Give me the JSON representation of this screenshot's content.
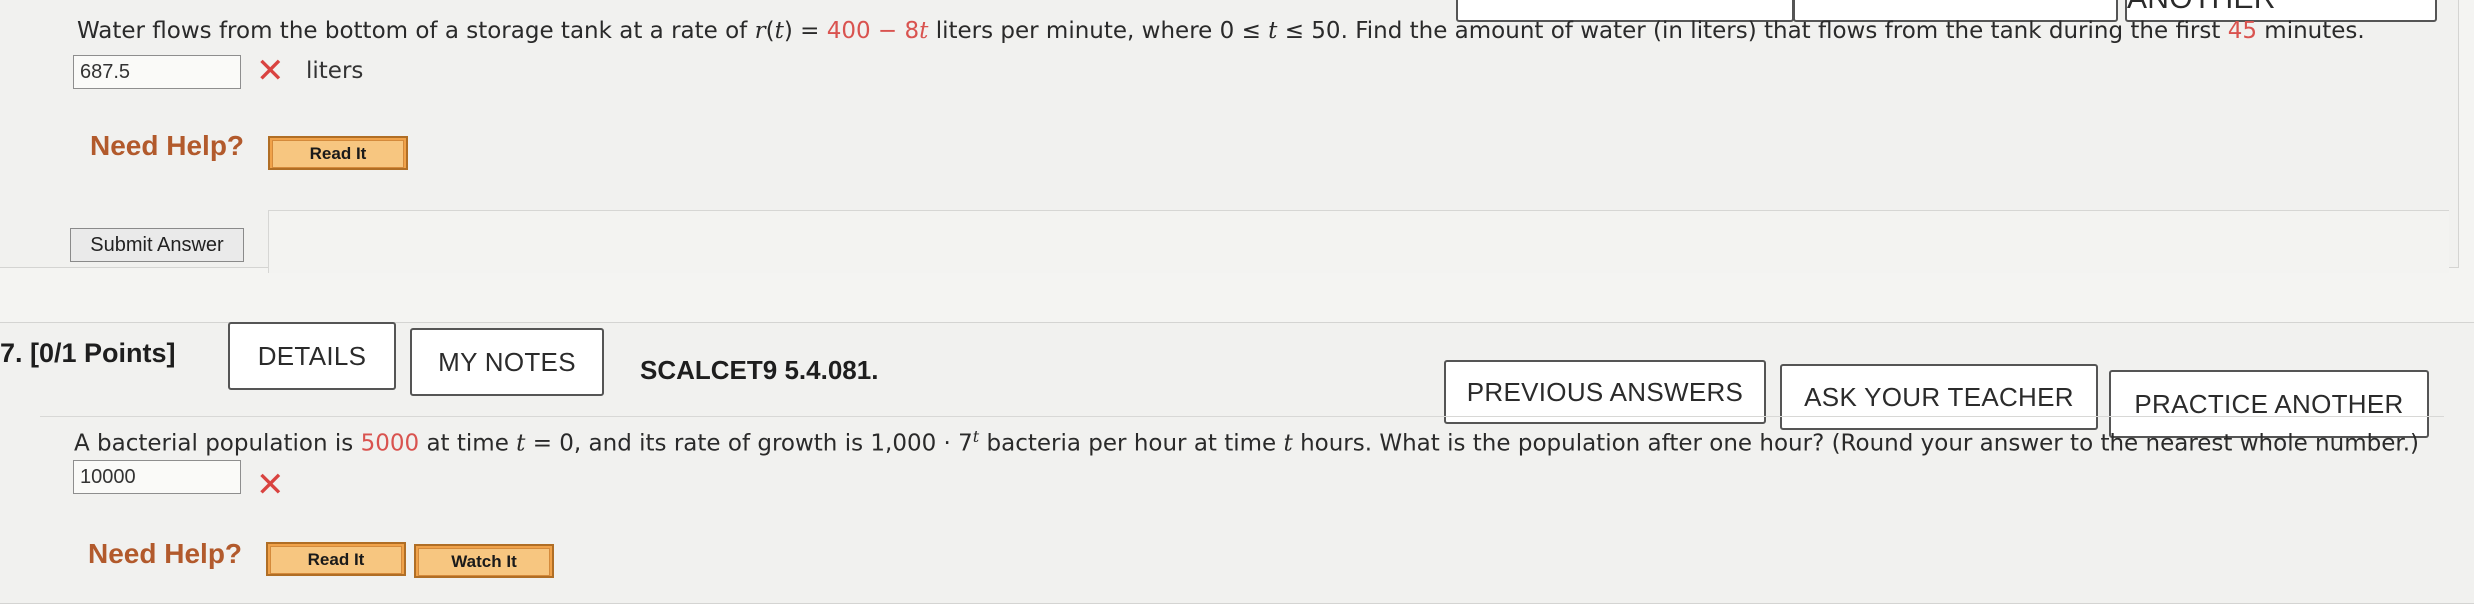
{
  "top_buttons": [
    "",
    "",
    "PRACTICE ANOTHER"
  ],
  "q6": {
    "text_prefix": "Water flows from the bottom of a storage tank at a rate of ",
    "func": "r",
    "var": "t",
    "equals": " = ",
    "expr_const": "400",
    "expr_minus": " − 8",
    "text_mid1": " liters per minute, where 0 ≤ ",
    "text_mid2": " ≤ 50. Find the amount of water (in liters) that flows from the tank during the first ",
    "minutes_value": "45",
    "text_suffix": " minutes.",
    "answer_value": "687.5",
    "unit": "liters",
    "need_help": "Need Help?",
    "read_it": "Read It",
    "submit": "Submit Answer"
  },
  "q7": {
    "number": "7.  [0/1 Points]",
    "details": "DETAILS",
    "my_notes": "MY NOTES",
    "code": "SCALCET9 5.4.081.",
    "previous_answers": "PREVIOUS ANSWERS",
    "ask_teacher": "ASK YOUR TEACHER",
    "practice_another": "PRACTICE ANOTHER",
    "text_prefix": "A bacterial population is ",
    "population": "5000",
    "text_mid1": " at time ",
    "var": "t",
    "text_mid2": " = 0, and its rate of growth is 1,000 · 7",
    "exponent": "t",
    "text_mid3": " bacteria per hour at time ",
    "text_suffix": " hours. What is the population after one hour? (Round your answer to the nearest whole number.)",
    "answer_value": "10000",
    "need_help": "Need Help?",
    "read_it": "Read It",
    "watch_it": "Watch It"
  }
}
